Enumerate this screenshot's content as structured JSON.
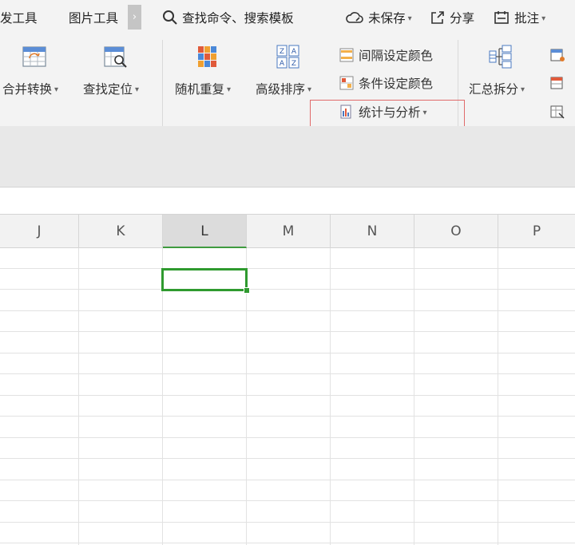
{
  "tabs": {
    "dev_tools": "发工具",
    "picture_tools": "图片工具",
    "more": "›",
    "search": "查找命令、搜索模板",
    "unsaved": "未保存",
    "share": "分享",
    "comment": "批注"
  },
  "ribbon": {
    "merge_convert": "合并转换",
    "find_locate": "查找定位",
    "random_repeat": "随机重复",
    "advanced_sort": "高级排序",
    "interval_color": "间隔设定颜色",
    "condition_color": "条件设定颜色",
    "stats_analysis": "统计与分析",
    "summary_split": "汇总拆分"
  },
  "columns": [
    "J",
    "K",
    "L",
    "M",
    "N",
    "O",
    "P"
  ],
  "selected_column": "L",
  "colors": {
    "accent_green": "#2f9a2f",
    "highlight_red": "#e06a6a",
    "ribbon_bg": "#f3f3f3"
  }
}
